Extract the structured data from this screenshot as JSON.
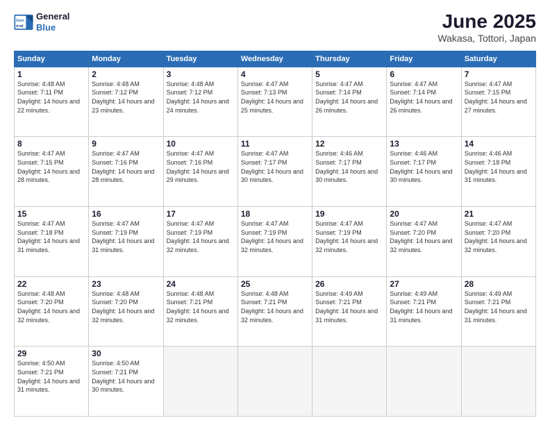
{
  "logo": {
    "line1": "General",
    "line2": "Blue"
  },
  "title": "June 2025",
  "subtitle": "Wakasa, Tottori, Japan",
  "headers": [
    "Sunday",
    "Monday",
    "Tuesday",
    "Wednesday",
    "Thursday",
    "Friday",
    "Saturday"
  ],
  "weeks": [
    [
      {
        "day": "1",
        "sunrise": "Sunrise: 4:48 AM",
        "sunset": "Sunset: 7:11 PM",
        "daylight": "Daylight: 14 hours and 22 minutes."
      },
      {
        "day": "2",
        "sunrise": "Sunrise: 4:48 AM",
        "sunset": "Sunset: 7:12 PM",
        "daylight": "Daylight: 14 hours and 23 minutes."
      },
      {
        "day": "3",
        "sunrise": "Sunrise: 4:48 AM",
        "sunset": "Sunset: 7:12 PM",
        "daylight": "Daylight: 14 hours and 24 minutes."
      },
      {
        "day": "4",
        "sunrise": "Sunrise: 4:47 AM",
        "sunset": "Sunset: 7:13 PM",
        "daylight": "Daylight: 14 hours and 25 minutes."
      },
      {
        "day": "5",
        "sunrise": "Sunrise: 4:47 AM",
        "sunset": "Sunset: 7:14 PM",
        "daylight": "Daylight: 14 hours and 26 minutes."
      },
      {
        "day": "6",
        "sunrise": "Sunrise: 4:47 AM",
        "sunset": "Sunset: 7:14 PM",
        "daylight": "Daylight: 14 hours and 26 minutes."
      },
      {
        "day": "7",
        "sunrise": "Sunrise: 4:47 AM",
        "sunset": "Sunset: 7:15 PM",
        "daylight": "Daylight: 14 hours and 27 minutes."
      }
    ],
    [
      {
        "day": "8",
        "sunrise": "Sunrise: 4:47 AM",
        "sunset": "Sunset: 7:15 PM",
        "daylight": "Daylight: 14 hours and 28 minutes."
      },
      {
        "day": "9",
        "sunrise": "Sunrise: 4:47 AM",
        "sunset": "Sunset: 7:16 PM",
        "daylight": "Daylight: 14 hours and 28 minutes."
      },
      {
        "day": "10",
        "sunrise": "Sunrise: 4:47 AM",
        "sunset": "Sunset: 7:16 PM",
        "daylight": "Daylight: 14 hours and 29 minutes."
      },
      {
        "day": "11",
        "sunrise": "Sunrise: 4:47 AM",
        "sunset": "Sunset: 7:17 PM",
        "daylight": "Daylight: 14 hours and 30 minutes."
      },
      {
        "day": "12",
        "sunrise": "Sunrise: 4:46 AM",
        "sunset": "Sunset: 7:17 PM",
        "daylight": "Daylight: 14 hours and 30 minutes."
      },
      {
        "day": "13",
        "sunrise": "Sunrise: 4:46 AM",
        "sunset": "Sunset: 7:17 PM",
        "daylight": "Daylight: 14 hours and 30 minutes."
      },
      {
        "day": "14",
        "sunrise": "Sunrise: 4:46 AM",
        "sunset": "Sunset: 7:18 PM",
        "daylight": "Daylight: 14 hours and 31 minutes."
      }
    ],
    [
      {
        "day": "15",
        "sunrise": "Sunrise: 4:47 AM",
        "sunset": "Sunset: 7:18 PM",
        "daylight": "Daylight: 14 hours and 31 minutes."
      },
      {
        "day": "16",
        "sunrise": "Sunrise: 4:47 AM",
        "sunset": "Sunset: 7:19 PM",
        "daylight": "Daylight: 14 hours and 31 minutes."
      },
      {
        "day": "17",
        "sunrise": "Sunrise: 4:47 AM",
        "sunset": "Sunset: 7:19 PM",
        "daylight": "Daylight: 14 hours and 32 minutes."
      },
      {
        "day": "18",
        "sunrise": "Sunrise: 4:47 AM",
        "sunset": "Sunset: 7:19 PM",
        "daylight": "Daylight: 14 hours and 32 minutes."
      },
      {
        "day": "19",
        "sunrise": "Sunrise: 4:47 AM",
        "sunset": "Sunset: 7:19 PM",
        "daylight": "Daylight: 14 hours and 32 minutes."
      },
      {
        "day": "20",
        "sunrise": "Sunrise: 4:47 AM",
        "sunset": "Sunset: 7:20 PM",
        "daylight": "Daylight: 14 hours and 32 minutes."
      },
      {
        "day": "21",
        "sunrise": "Sunrise: 4:47 AM",
        "sunset": "Sunset: 7:20 PM",
        "daylight": "Daylight: 14 hours and 32 minutes."
      }
    ],
    [
      {
        "day": "22",
        "sunrise": "Sunrise: 4:48 AM",
        "sunset": "Sunset: 7:20 PM",
        "daylight": "Daylight: 14 hours and 32 minutes."
      },
      {
        "day": "23",
        "sunrise": "Sunrise: 4:48 AM",
        "sunset": "Sunset: 7:20 PM",
        "daylight": "Daylight: 14 hours and 32 minutes."
      },
      {
        "day": "24",
        "sunrise": "Sunrise: 4:48 AM",
        "sunset": "Sunset: 7:21 PM",
        "daylight": "Daylight: 14 hours and 32 minutes."
      },
      {
        "day": "25",
        "sunrise": "Sunrise: 4:48 AM",
        "sunset": "Sunset: 7:21 PM",
        "daylight": "Daylight: 14 hours and 32 minutes."
      },
      {
        "day": "26",
        "sunrise": "Sunrise: 4:49 AM",
        "sunset": "Sunset: 7:21 PM",
        "daylight": "Daylight: 14 hours and 31 minutes."
      },
      {
        "day": "27",
        "sunrise": "Sunrise: 4:49 AM",
        "sunset": "Sunset: 7:21 PM",
        "daylight": "Daylight: 14 hours and 31 minutes."
      },
      {
        "day": "28",
        "sunrise": "Sunrise: 4:49 AM",
        "sunset": "Sunset: 7:21 PM",
        "daylight": "Daylight: 14 hours and 31 minutes."
      }
    ],
    [
      {
        "day": "29",
        "sunrise": "Sunrise: 4:50 AM",
        "sunset": "Sunset: 7:21 PM",
        "daylight": "Daylight: 14 hours and 31 minutes."
      },
      {
        "day": "30",
        "sunrise": "Sunrise: 4:50 AM",
        "sunset": "Sunset: 7:21 PM",
        "daylight": "Daylight: 14 hours and 30 minutes."
      },
      null,
      null,
      null,
      null,
      null
    ]
  ]
}
